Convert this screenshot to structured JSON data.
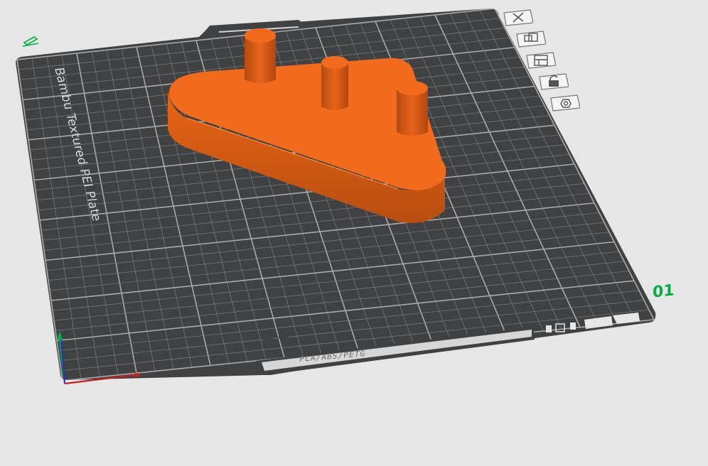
{
  "plate": {
    "name": "Bambu Textured PEI Plate",
    "number": "01",
    "filament_types": "PLA/ABS/PETG"
  },
  "toolbar": {
    "tools": [
      {
        "name": "close",
        "icon": "close-icon"
      },
      {
        "name": "auto-arrange",
        "icon": "arrange-icon"
      },
      {
        "name": "plate-layout",
        "icon": "layout-icon"
      },
      {
        "name": "lock-plate",
        "icon": "lock-icon"
      },
      {
        "name": "plate-settings",
        "icon": "settings-icon"
      }
    ]
  },
  "model": {
    "color": "#f26b1d",
    "shade": "#c4531a",
    "dark": "#a9430f"
  },
  "colors": {
    "background": "#e6e6e6",
    "plate": "#3f4143",
    "grid": "#8b8c8d",
    "accent": "#00ae42",
    "axis_x": "#c81e1e",
    "axis_y": "#00ae42",
    "axis_z": "#1e2ad0"
  }
}
